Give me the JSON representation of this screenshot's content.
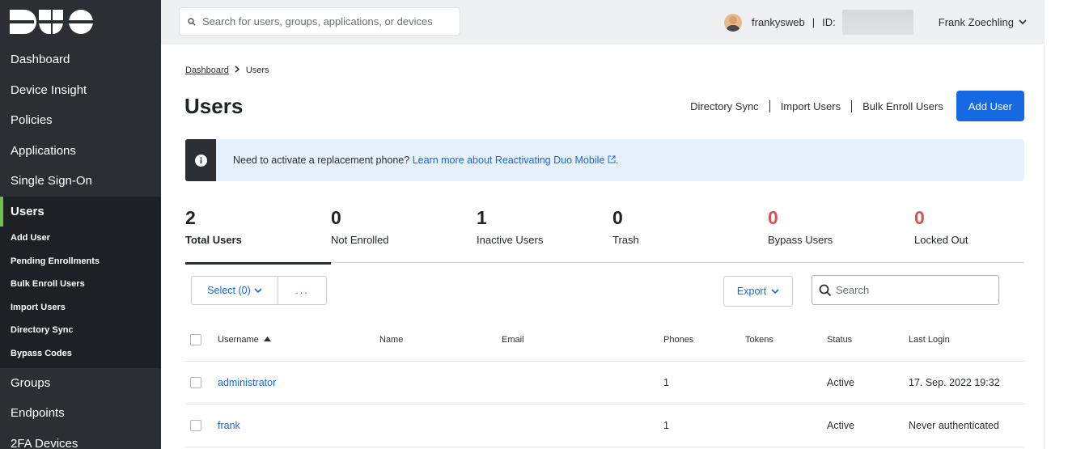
{
  "sidebar": {
    "logo_text": "DUO",
    "items": [
      {
        "label": "Dashboard"
      },
      {
        "label": "Device Insight"
      },
      {
        "label": "Policies"
      },
      {
        "label": "Applications"
      },
      {
        "label": "Single Sign-On"
      },
      {
        "label": "Users"
      }
    ],
    "sub_items": [
      {
        "label": "Add User"
      },
      {
        "label": "Pending Enrollments"
      },
      {
        "label": "Bulk Enroll Users"
      },
      {
        "label": "Import Users"
      },
      {
        "label": "Directory Sync"
      },
      {
        "label": "Bypass Codes"
      }
    ],
    "items_after": [
      {
        "label": "Groups"
      },
      {
        "label": "Endpoints"
      },
      {
        "label": "2FA Devices"
      }
    ],
    "active_color": "#6dc04a"
  },
  "topbar": {
    "search_placeholder": "Search for users, groups, applications, or devices",
    "account": "frankysweb",
    "separator": "|",
    "id_label": "ID:",
    "user_name": "Frank Zoechling"
  },
  "breadcrumb": {
    "root": "Dashboard",
    "separator": ">",
    "current": "Users"
  },
  "page": {
    "title": "Users",
    "actions": {
      "directory_sync": "Directory Sync",
      "import_users": "Import Users",
      "bulk_enroll": "Bulk Enroll Users",
      "add_user": "Add User"
    }
  },
  "banner": {
    "text": "Need to activate a replacement phone?",
    "link": "Learn more about Reactivating Duo Mobile",
    "link_suffix": "."
  },
  "stats": [
    {
      "value": "2",
      "label": "Total Users"
    },
    {
      "value": "0",
      "label": "Not Enrolled"
    },
    {
      "value": "1",
      "label": "Inactive Users"
    },
    {
      "value": "0",
      "label": "Trash"
    },
    {
      "value": "0",
      "label": "Bypass Users"
    },
    {
      "value": "0",
      "label": "Locked Out"
    }
  ],
  "toolbar": {
    "select_label": "Select (0)",
    "more_label": "...",
    "export_label": "Export",
    "search_placeholder": "Search"
  },
  "table": {
    "headers": {
      "username": "Username",
      "name": "Name",
      "email": "Email",
      "phones": "Phones",
      "tokens": "Tokens",
      "status": "Status",
      "last_login": "Last Login"
    },
    "rows": [
      {
        "username": "administrator",
        "name": "",
        "email": "",
        "phones": "1",
        "tokens": "",
        "status": "Active",
        "last_login": "17. Sep. 2022 19:32"
      },
      {
        "username": "frank",
        "name": "",
        "email": "",
        "phones": "1",
        "tokens": "",
        "status": "Active",
        "last_login": "Never authenticated"
      }
    ]
  },
  "colors": {
    "primary": "#1668e3",
    "danger": "#d9534f",
    "sidebar_bg": "#2b2f33",
    "banner_bg": "#e6f1fd"
  }
}
